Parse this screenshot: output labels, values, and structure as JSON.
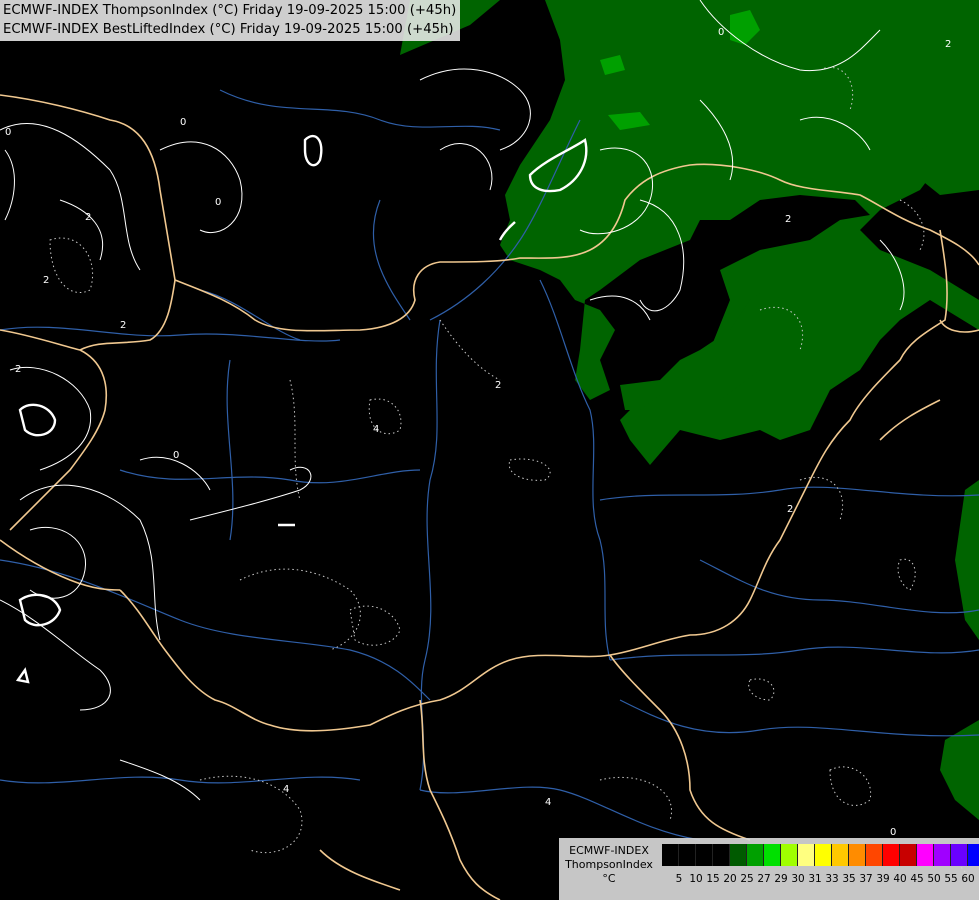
{
  "title": {
    "line1": "ECMWF-INDEX ThompsonIndex (°C) Friday 19-09-2025 15:00 (+45h)",
    "line2": "ECMWF-INDEX BestLiftedIndex (°C) Friday 19-09-2025 15:00 (+45h)"
  },
  "map": {
    "background": "#000000",
    "region_fill_color": "#006400",
    "region_fill_light": "#00a000",
    "border_color": "#f0c890",
    "river_color": "#2f5fa8",
    "contour_color": "#ffffff",
    "contour_labels": [
      "0",
      "0",
      "0",
      "2",
      "2",
      "2",
      "2",
      "4",
      "2",
      "0",
      "2",
      "4",
      "2",
      "4",
      "2",
      "0",
      "0"
    ]
  },
  "legend": {
    "model": "ECMWF-INDEX",
    "parameter": "ThompsonIndex",
    "unit": "°C",
    "ticks": [
      "5",
      "10",
      "15",
      "20",
      "25",
      "27",
      "29",
      "30",
      "31",
      "33",
      "35",
      "37",
      "39",
      "40",
      "45",
      "50",
      "55",
      "60"
    ],
    "colors": [
      "#000000",
      "#000000",
      "#000000",
      "#000000",
      "#005a00",
      "#00a000",
      "#00e000",
      "#a0ff00",
      "#ffff80",
      "#ffff00",
      "#ffc800",
      "#ff8c00",
      "#ff4600",
      "#ff0000",
      "#c80000",
      "#ff00ff",
      "#a000ff",
      "#6a00ff",
      "#0000ff"
    ]
  }
}
